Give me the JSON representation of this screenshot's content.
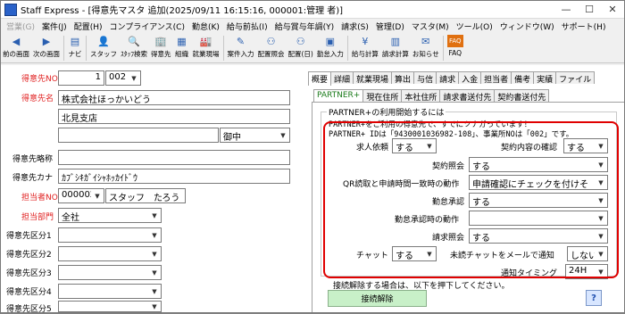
{
  "titlebar": {
    "title": "Staff Express - [得意先マスタ 追加(2025/09/11 16:15:16, 000001:管理 者)]"
  },
  "menu": [
    {
      "label": "営業(G)",
      "disabled": true
    },
    {
      "label": "案件(J)",
      "disabled": false
    },
    {
      "label": "配置(H)",
      "disabled": false
    },
    {
      "label": "コンプライアンス(C)",
      "disabled": false
    },
    {
      "label": "勤怠(K)",
      "disabled": false
    },
    {
      "label": "給与前払(I)",
      "disabled": false
    },
    {
      "label": "給与賞与年調(Y)",
      "disabled": false
    },
    {
      "label": "請求(S)",
      "disabled": false
    },
    {
      "label": "管理(D)",
      "disabled": false
    },
    {
      "label": "マスタ(M)",
      "disabled": false
    },
    {
      "label": "ツール(O)",
      "disabled": false
    },
    {
      "label": "ウィンドウ(W)",
      "disabled": false
    },
    {
      "label": "サポート(H)",
      "disabled": false
    }
  ],
  "toolbar": [
    {
      "label": "前の画面",
      "icon": "back-arrow-icon",
      "glyph": "◀"
    },
    {
      "label": "次の画面",
      "icon": "forward-arrow-icon",
      "glyph": "▶"
    },
    {
      "label": "ナビ",
      "icon": "navi-icon",
      "glyph": "▤"
    },
    {
      "label": "スタッフ",
      "icon": "staff-icon",
      "glyph": "👤"
    },
    {
      "label": "ｽﾀｯﾌ検索",
      "icon": "staff-search-icon",
      "glyph": "🔍"
    },
    {
      "label": "得意先",
      "icon": "client-icon",
      "glyph": "🏢"
    },
    {
      "label": "組織",
      "icon": "organization-icon",
      "glyph": "▦"
    },
    {
      "label": "就業現場",
      "icon": "workplace-icon",
      "glyph": "🏭"
    },
    {
      "label": "案件入力",
      "icon": "job-entry-icon",
      "glyph": "✎"
    },
    {
      "label": "配置照会",
      "icon": "assignment-inquiry-icon",
      "glyph": "⚇"
    },
    {
      "label": "配置(日)",
      "icon": "assignment-daily-icon",
      "glyph": "⚇"
    },
    {
      "label": "勤怠入力",
      "icon": "attendance-entry-icon",
      "glyph": "▣"
    },
    {
      "label": "給与計算",
      "icon": "payroll-icon",
      "glyph": "¥"
    },
    {
      "label": "請求計算",
      "icon": "billing-icon",
      "glyph": "▥"
    },
    {
      "label": "お知らせ",
      "icon": "notice-icon",
      "glyph": "✉"
    },
    {
      "label": "FAQ",
      "icon": "faq-icon",
      "glyph": "FAQ"
    }
  ],
  "form": {
    "client_no_label": "得意先NO",
    "client_no_value": "1",
    "client_no_branch": "002",
    "client_name_label": "得意先名",
    "client_name_value": "株式会社ほっかいどう",
    "client_name_line2": "北見支店",
    "client_name_select": "御中",
    "client_alias_label": "得意先略称",
    "client_kana_label": "得意先カナ",
    "client_kana_value": "ｶﾌﾞｼｷｶﾞｲｼｬﾎｯｶｲﾄﾞｳ",
    "staff_label": "担当者NO",
    "staff_no_value": "000002",
    "staff_name_value": "スタッフ　たろう",
    "dept_label": "担当部門",
    "dept_value": "全社",
    "class1_label": "得意先区分1",
    "class2_label": "得意先区分2",
    "class3_label": "得意先区分3",
    "class4_label": "得意先区分4",
    "class5_label": "得意先区分5"
  },
  "tabs": [
    "概要",
    "詳細",
    "就業現場",
    "算出",
    "与信",
    "請求",
    "入金",
    "担当者",
    "備考",
    "実績",
    "ファイル"
  ],
  "active_tab": "概要",
  "subtabs": [
    "PARTNER+",
    "現在住所",
    "本社住所",
    "請求書送付先",
    "契約書送付先"
  ],
  "active_subtab": "PARTNER+",
  "partner": {
    "group_title": "PARTNER+の利用開始するには",
    "info_line1": "PARTNER+をご利用の得意先で、すでにツナガっています！",
    "info_line2": "PARTNER+ IDは「9430001036982-108」、事業所NOは「002」です。",
    "request_label": "求人依頼",
    "request_value": "する",
    "contract_confirm_label": "契約内容の確認",
    "contract_confirm_value": "する",
    "contract_inquiry_label": "契約照会",
    "contract_inquiry_value": "する",
    "qr_label": "QR読取と申請時間一致時の動作",
    "qr_value": "申請確認にチェックを付けそ",
    "attendance_approval_label": "勤怠承認",
    "attendance_approval_value": "する",
    "attendance_action_label": "勤怠承認時の動作",
    "attendance_action_value": "",
    "billing_inquiry_label": "請求照会",
    "billing_inquiry_value": "する",
    "chat_label": "チャット",
    "chat_value": "する",
    "unread_label": "未読チャットをメールで通知",
    "unread_value": "しない",
    "notify_timing_label": "通知タイミング",
    "notify_timing_value": "24H",
    "disconnect_text": "接続解除する場合は、以下を押下してください。",
    "disconnect_button": "接続解除",
    "help_label": "?"
  }
}
